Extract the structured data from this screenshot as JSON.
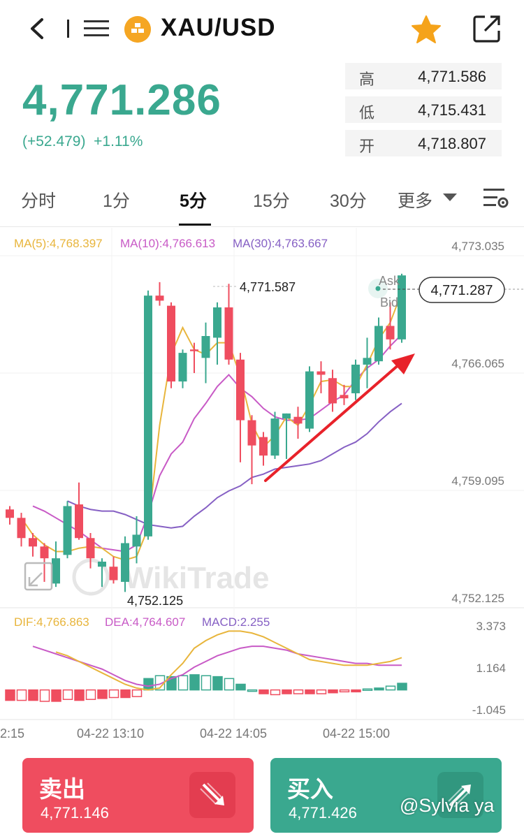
{
  "header": {
    "symbol": "XAU/USD"
  },
  "quote": {
    "price": "4,771.286",
    "change": "(+52.479)",
    "change_pct": "+1.11%",
    "high_label": "高",
    "high": "4,771.586",
    "low_label": "低",
    "low": "4,715.431",
    "open_label": "开",
    "open": "4,718.807"
  },
  "tabs": [
    "分时",
    "1分",
    "5分",
    "15分",
    "30分",
    "更多"
  ],
  "active_tab": "5分",
  "chart": {
    "ma_legend": [
      {
        "text": "MA(5):4,768.397",
        "color": "#e8b53c"
      },
      {
        "text": "MA(10):4,766.613",
        "color": "#c85ac6"
      },
      {
        "text": "MA(30):4,763.667",
        "color": "#8660c4"
      }
    ],
    "y_ticks": [
      "4,773.035",
      "4,766.065",
      "4,759.095",
      "4,752.125"
    ],
    "high_annot": "4,771.587",
    "low_annot": "4,752.125",
    "ask_label": "Ask",
    "bid_label": "Bid",
    "current_price_tag": "4,771.287",
    "watermark_text": "WikiTrade",
    "macd_legend": [
      {
        "text": "DIF:4,766.863",
        "color": "#e8b53c"
      },
      {
        "text": "DEA:4,764.607",
        "color": "#c85ac6"
      },
      {
        "text": "MACD:2.255",
        "color": "#8660c4"
      }
    ],
    "macd_y_ticks": [
      "3.373",
      "1.164",
      "-1.045"
    ],
    "x_ticks": [
      "2:15",
      "04-22 13:10",
      "04-22 14:05",
      "04-22 15:00"
    ],
    "up_color": "#3aa88f",
    "down_color": "#ef4d5f"
  },
  "chart_data": {
    "type": "candlestick",
    "y_range": [
      4752.125,
      4773.035
    ],
    "candles": [
      {
        "o": 4757.3,
        "h": 4757.5,
        "l": 4756.4,
        "c": 4756.8
      },
      {
        "o": 4756.8,
        "h": 4757.1,
        "l": 4755.1,
        "c": 4755.6
      },
      {
        "o": 4755.6,
        "h": 4755.9,
        "l": 4754.5,
        "c": 4755.1
      },
      {
        "o": 4755.1,
        "h": 4755.3,
        "l": 4753.0,
        "c": 4754.4
      },
      {
        "o": 4752.9,
        "h": 4755.4,
        "l": 4752.7,
        "c": 4754.4
      },
      {
        "o": 4754.6,
        "h": 4757.8,
        "l": 4754.4,
        "c": 4757.5
      },
      {
        "o": 4757.6,
        "h": 4758.9,
        "l": 4755.5,
        "c": 4755.6
      },
      {
        "o": 4755.6,
        "h": 4755.9,
        "l": 4753.8,
        "c": 4754.4
      },
      {
        "o": 4753.9,
        "h": 4754.4,
        "l": 4752.7,
        "c": 4754.2
      },
      {
        "o": 4753.9,
        "h": 4754.5,
        "l": 4752.9,
        "c": 4753.1
      },
      {
        "o": 4753.0,
        "h": 4755.7,
        "l": 4752.4,
        "c": 4755.3
      },
      {
        "o": 4755.1,
        "h": 4756.9,
        "l": 4754.1,
        "c": 4755.8
      },
      {
        "o": 4755.7,
        "h": 4770.3,
        "l": 4755.5,
        "c": 4770.0
      },
      {
        "o": 4770.0,
        "h": 4770.8,
        "l": 4769.4,
        "c": 4769.7
      },
      {
        "o": 4769.4,
        "h": 4769.6,
        "l": 4764.5,
        "c": 4764.9
      },
      {
        "o": 4764.9,
        "h": 4766.8,
        "l": 4764.5,
        "c": 4766.6
      },
      {
        "o": 4766.8,
        "h": 4767.2,
        "l": 4765.4,
        "c": 4766.7
      },
      {
        "o": 4766.3,
        "h": 4768.4,
        "l": 4764.8,
        "c": 4767.6
      },
      {
        "o": 4767.5,
        "h": 4769.6,
        "l": 4765.9,
        "c": 4769.3
      },
      {
        "o": 4769.3,
        "h": 4770.7,
        "l": 4765.9,
        "c": 4766.2
      },
      {
        "o": 4766.2,
        "h": 4766.6,
        "l": 4760.1,
        "c": 4762.6
      },
      {
        "o": 4762.6,
        "h": 4762.9,
        "l": 4758.8,
        "c": 4761.1
      },
      {
        "o": 4761.6,
        "h": 4761.9,
        "l": 4759.9,
        "c": 4760.5
      },
      {
        "o": 4760.5,
        "h": 4763.1,
        "l": 4760.3,
        "c": 4762.7
      },
      {
        "o": 4762.7,
        "h": 4763.0,
        "l": 4760.3,
        "c": 4763.0
      },
      {
        "o": 4762.8,
        "h": 4763.4,
        "l": 4761.5,
        "c": 4762.4
      },
      {
        "o": 4762.1,
        "h": 4765.8,
        "l": 4761.9,
        "c": 4765.5
      },
      {
        "o": 4765.5,
        "h": 4766.1,
        "l": 4764.2,
        "c": 4765.3
      },
      {
        "o": 4765.1,
        "h": 4765.6,
        "l": 4763.1,
        "c": 4763.6
      },
      {
        "o": 4764.1,
        "h": 4764.7,
        "l": 4763.5,
        "c": 4763.9
      },
      {
        "o": 4764.2,
        "h": 4766.2,
        "l": 4763.8,
        "c": 4765.9
      },
      {
        "o": 4765.9,
        "h": 4767.5,
        "l": 4764.5,
        "c": 4766.3
      },
      {
        "o": 4766.1,
        "h": 4768.7,
        "l": 4765.9,
        "c": 4768.2
      },
      {
        "o": 4768.2,
        "h": 4769.6,
        "l": 4766.8,
        "c": 4767.4
      },
      {
        "o": 4767.4,
        "h": 4771.3,
        "l": 4767.2,
        "c": 4771.2
      }
    ],
    "ma5": [
      4756.8,
      4755.8,
      4755.2,
      4754.8,
      4754.8,
      4755.0,
      4755.1,
      4755.0,
      4754.5,
      4754.3,
      4754.5,
      4756.2,
      4762.3,
      4766.5,
      4768.1,
      4766.8,
      4766.5,
      4767.2,
      4767.2,
      4765.2,
      4762.4,
      4761.0,
      4761.7,
      4762.8,
      4762.3,
      4763.5,
      4764.9,
      4765.0,
      4764.6,
      4764.6,
      4765.9,
      4767.4,
      4768.4,
      4770.2
    ],
    "ma10": [
      4757.5,
      4757.2,
      4756.8,
      4756.4,
      4756.0,
      4755.5,
      4755.0,
      4754.9,
      4754.8,
      4755.2,
      4757.0,
      4759.3,
      4760.6,
      4761.3,
      4762.7,
      4763.6,
      4764.6,
      4765.3,
      4764.5,
      4764.0,
      4763.3,
      4762.8,
      4762.6,
      4762.6,
      4762.7,
      4763.2,
      4763.7,
      4764.1,
      4765.0,
      4765.7,
      4766.2,
      4767.0,
      4767.7
    ],
    "ma30": [
      4757.8,
      4757.5,
      4757.3,
      4757.2,
      4757.2,
      4757.0,
      4756.7,
      4756.4,
      4756.3,
      4756.2,
      4756.3,
      4756.9,
      4757.4,
      4758.0,
      4758.4,
      4758.7,
      4759.2,
      4759.4,
      4759.7,
      4759.8,
      4759.9,
      4760.0,
      4760.2,
      4760.6,
      4761.0,
      4761.3,
      4761.8,
      4762.5,
      4763.1,
      4763.6
    ],
    "macd": {
      "range": [
        -1.045,
        3.373
      ],
      "dif": [
        2.0,
        1.8,
        1.5,
        1.2,
        0.9,
        0.6,
        0.3,
        0.1,
        0.0,
        0.1,
        0.8,
        1.4,
        2.2,
        2.6,
        2.9,
        3.1,
        3.1,
        3.0,
        2.8,
        2.5,
        2.2,
        1.9,
        1.6,
        1.5,
        1.4,
        1.3,
        1.3,
        1.3,
        1.4,
        1.5,
        1.7
      ],
      "dea": [
        2.3,
        2.1,
        1.9,
        1.7,
        1.5,
        1.3,
        1.1,
        0.8,
        0.5,
        0.3,
        0.2,
        0.3,
        0.6,
        0.8,
        1.2,
        1.5,
        1.8,
        2.0,
        2.2,
        2.3,
        2.3,
        2.2,
        2.1,
        1.9,
        1.8,
        1.7,
        1.6,
        1.5,
        1.4,
        1.4,
        1.3,
        1.3,
        1.3
      ],
      "hist": [
        -0.55,
        -0.55,
        -0.55,
        -0.6,
        -0.6,
        -0.5,
        -0.55,
        -0.5,
        -0.45,
        -0.4,
        -0.4,
        -0.35,
        0.6,
        0.75,
        0.7,
        0.75,
        0.8,
        0.75,
        0.7,
        0.6,
        0.3,
        0.0,
        -0.2,
        -0.25,
        -0.2,
        -0.2,
        -0.2,
        -0.2,
        -0.15,
        -0.1,
        -0.1,
        0.05,
        0.1,
        0.2,
        0.35
      ]
    }
  },
  "sell": {
    "label": "卖出",
    "price": "4,771.146"
  },
  "buy": {
    "label": "买入",
    "price": "4,771.426"
  },
  "watermark": "@Sylvia ya"
}
